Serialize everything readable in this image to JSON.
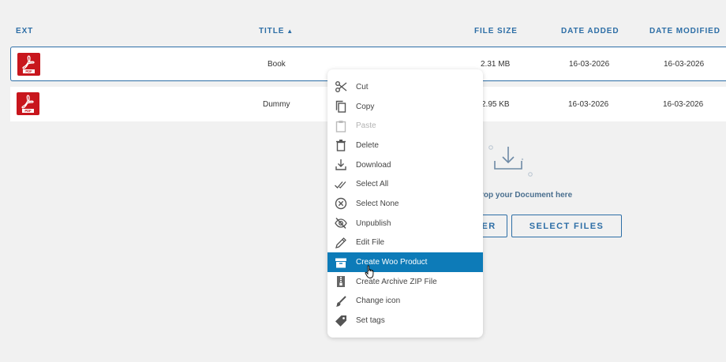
{
  "table": {
    "headers": {
      "ext": "EXT",
      "title": "TITLE",
      "sort_indicator": "▲",
      "file_size": "FILE SIZE",
      "date_added": "DATE ADDED",
      "date_modified": "DATE MODIFIED"
    },
    "rows": [
      {
        "icon": "pdf-icon",
        "icon_text": "PDF",
        "title": "Book",
        "file_size": "2.31 MB",
        "date_added": "16-03-2026",
        "date_modified": "16-03-2026"
      },
      {
        "icon": "pdf-icon",
        "icon_text": "PDF",
        "title": "Dummy",
        "file_size": "2.95 KB",
        "date_added": "16-03-2026",
        "date_modified": "16-03-2026"
      }
    ]
  },
  "dropzone": {
    "icon": "download-tray-icon",
    "text": "rop your Document here",
    "button_partial": "ER",
    "select_files_label": "SELECT FILES"
  },
  "context_menu": {
    "items": [
      {
        "label": "Cut",
        "icon": "scissors-icon",
        "state": "normal"
      },
      {
        "label": "Copy",
        "icon": "copy-icon",
        "state": "normal"
      },
      {
        "label": "Paste",
        "icon": "clipboard-icon",
        "state": "disabled"
      },
      {
        "label": "Delete",
        "icon": "trash-icon",
        "state": "normal"
      },
      {
        "label": "Download",
        "icon": "download-icon",
        "state": "normal"
      },
      {
        "label": "Select All",
        "icon": "double-check-icon",
        "state": "normal"
      },
      {
        "label": "Select None",
        "icon": "circle-x-icon",
        "state": "normal"
      },
      {
        "label": "Unpublish",
        "icon": "eye-off-icon",
        "state": "normal"
      },
      {
        "label": "Edit File",
        "icon": "pencil-icon",
        "state": "normal"
      },
      {
        "label": "Create Woo Product",
        "icon": "box-icon",
        "state": "active"
      },
      {
        "label": "Create Archive ZIP File",
        "icon": "zip-icon",
        "state": "normal"
      },
      {
        "label": "Change icon",
        "icon": "brush-icon",
        "state": "normal"
      },
      {
        "label": "Set tags",
        "icon": "tag-icon",
        "state": "normal"
      }
    ]
  },
  "colors": {
    "accent": "#2d6ea6",
    "menu_highlight": "#0d7bb8",
    "pdf_red": "#c8161d",
    "background": "#f1f1f1"
  }
}
